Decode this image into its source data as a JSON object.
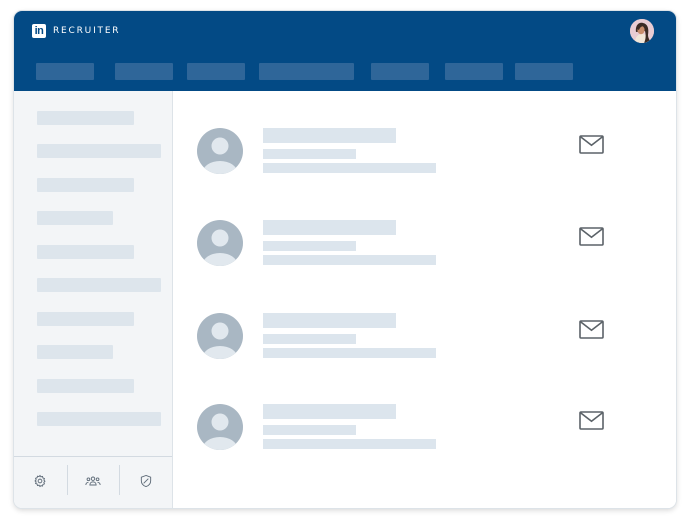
{
  "header": {
    "logo_text": "in",
    "brand": "RECRUITER",
    "colors": {
      "header_bg": "#034a85",
      "placeholder_bar": "#2f6699"
    },
    "nav_items": 7
  },
  "sidebar": {
    "item_count": 10,
    "footer_icons": [
      "gear-icon",
      "people-icon",
      "shield-icon"
    ]
  },
  "main": {
    "candidates": [
      {
        "avatar": "avatar-placeholder-icon",
        "action": "envelope-icon"
      },
      {
        "avatar": "avatar-placeholder-icon",
        "action": "envelope-icon"
      },
      {
        "avatar": "avatar-placeholder-icon",
        "action": "envelope-icon"
      },
      {
        "avatar": "avatar-placeholder-icon",
        "action": "envelope-icon"
      }
    ]
  }
}
